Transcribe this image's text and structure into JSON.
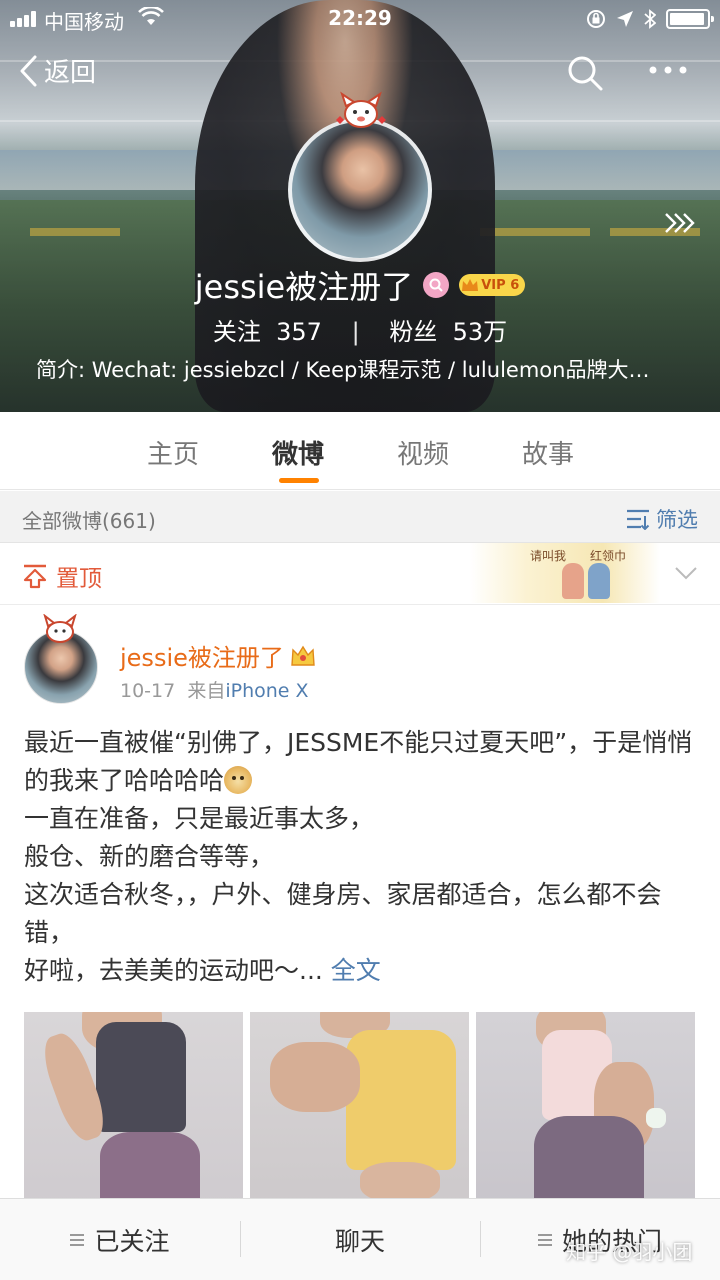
{
  "status_bar": {
    "carrier": "中国移动",
    "time": "22:29"
  },
  "nav": {
    "back_label": "返回",
    "search_icon": "search-icon",
    "more_icon": "more-icon"
  },
  "profile": {
    "name": "jessie被注册了",
    "vip_label": "VIP 6",
    "following_label": "关注",
    "following_count": "357",
    "separator": "|",
    "followers_label": "粉丝",
    "followers_count": "53万",
    "bio": "简介: Wechat: jessiebzcl / Keep课程示范 / lululemon品牌大…"
  },
  "tabs": [
    {
      "label": "主页"
    },
    {
      "label": "微博"
    },
    {
      "label": "视频"
    },
    {
      "label": "故事"
    }
  ],
  "active_tab": "微博",
  "filter_bar": {
    "count_label": "全部微博(661)",
    "filter_label": "筛选"
  },
  "pinned": {
    "label": "置顶",
    "banner_text": "请叫我　　红领巾"
  },
  "post": {
    "author": "jessie被注册了",
    "date": "10-17",
    "source_prefix": "来自",
    "source": "iPhone X",
    "lines": [
      "最近一直被催“别佛了，JESSME不能只过夏天吧”，于是悄悄的我来了哈哈哈哈",
      "一直在准备，只是最近事太多，",
      "般仓、新的磨合等等，",
      "这次适合秋冬，，户外、健身房、家居都适合，怎么都不会错，",
      "好啦，去美美的运动吧～..."
    ],
    "more_label": "全文"
  },
  "bottom_bar": {
    "follow_label": "已关注",
    "chat_label": "聊天",
    "hot_label": "她的热门"
  },
  "watermark": "知乎 @羽小团",
  "colors": {
    "accent": "#ff8200",
    "link": "#507daf",
    "username": "#e86b18",
    "pinned": "#e25a3a"
  }
}
